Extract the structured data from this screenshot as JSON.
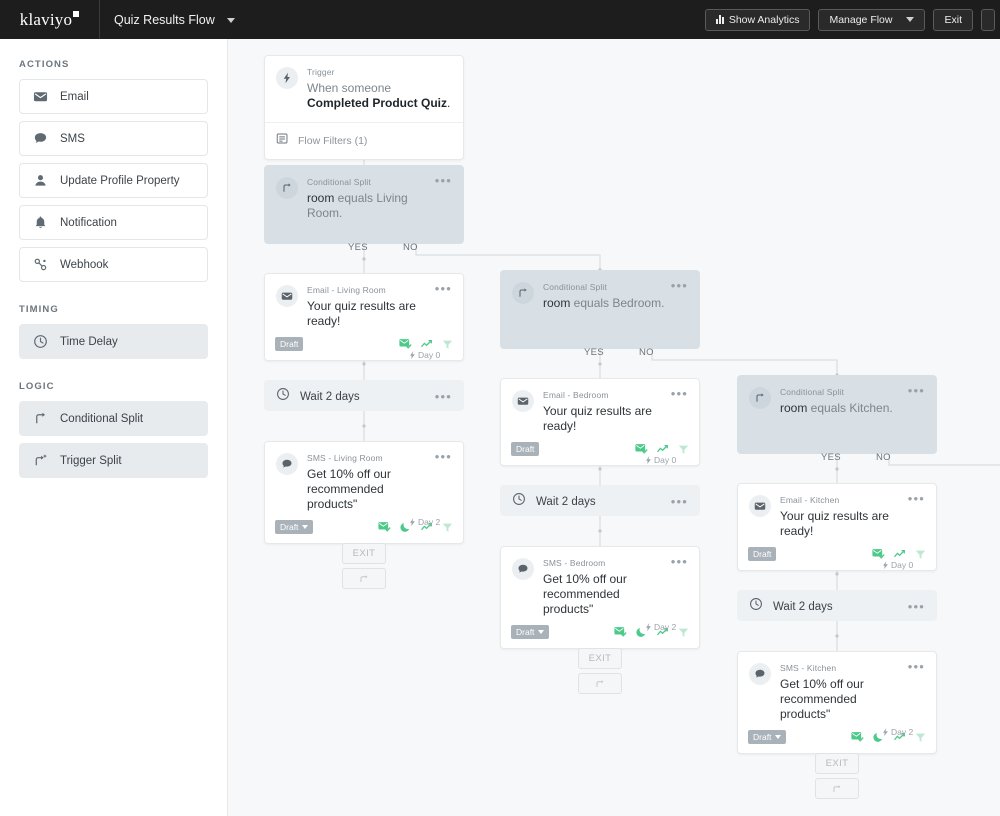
{
  "topbar": {
    "logo": "klaviyo",
    "flow_name": "Quiz Results Flow",
    "show_analytics": "Show Analytics",
    "manage_flow": "Manage Flow",
    "exit": "Exit"
  },
  "sidebar": {
    "actions_label": "ACTIONS",
    "timing_label": "TIMING",
    "logic_label": "LOGIC",
    "actions": [
      {
        "label": "Email",
        "icon": "envelope-icon"
      },
      {
        "label": "SMS",
        "icon": "chat-bubble-icon"
      },
      {
        "label": "Update Profile Property",
        "icon": "person-icon"
      },
      {
        "label": "Notification",
        "icon": "bell-icon"
      },
      {
        "label": "Webhook",
        "icon": "webhook-icon"
      }
    ],
    "timing": [
      {
        "label": "Time Delay",
        "icon": "clock-icon"
      }
    ],
    "logic": [
      {
        "label": "Conditional Split",
        "icon": "split-icon"
      },
      {
        "label": "Trigger Split",
        "icon": "trigger-split-icon"
      }
    ]
  },
  "canvas": {
    "trigger": {
      "type": "Trigger",
      "title_pre": "When someone ",
      "title_bold": "Completed Product Quiz",
      "title_post": ".",
      "filters": "Flow Filters (1)"
    },
    "yes_label": "YES",
    "no_label": "NO",
    "exit_label": "EXIT",
    "draft_label": "Draft",
    "splits": [
      {
        "type": "Conditional Split",
        "prop": "room",
        "op": " equals ",
        "value": "Living Room."
      },
      {
        "type": "Conditional Split",
        "prop": "room",
        "op": " equals ",
        "value": "Bedroom."
      },
      {
        "type": "Conditional Split",
        "prop": "room",
        "op": " equals ",
        "value": "Kitchen."
      }
    ],
    "branches": [
      {
        "email": {
          "type": "Email - Living Room",
          "title": "Your quiz results are ready!",
          "day": "Day 0"
        },
        "wait": {
          "title": "Wait 2 days"
        },
        "sms": {
          "type": "SMS - Living Room",
          "title": "Get 10% off our recommended products\"",
          "day": "Day 2"
        }
      },
      {
        "email": {
          "type": "Email - Bedroom",
          "title": "Your quiz results are ready!",
          "day": "Day 0"
        },
        "wait": {
          "title": "Wait 2 days"
        },
        "sms": {
          "type": "SMS - Bedroom",
          "title": "Get 10% off our recommended products\"",
          "day": "Day 2"
        }
      },
      {
        "email": {
          "type": "Email - Kitchen",
          "title": "Your quiz results are ready!",
          "day": "Day 0"
        },
        "wait": {
          "title": "Wait 2 days"
        },
        "sms": {
          "type": "SMS - Kitchen",
          "title": "Get 10% off our recommended products\"",
          "day": "Day 2"
        }
      }
    ]
  },
  "colors": {
    "topbar_bg": "#1d1d1d",
    "canvas_bg": "#f6f8f9",
    "split_bg": "#d9e0e5",
    "status_green": "#4dc98a",
    "badge_gray": "#aab2b9"
  }
}
